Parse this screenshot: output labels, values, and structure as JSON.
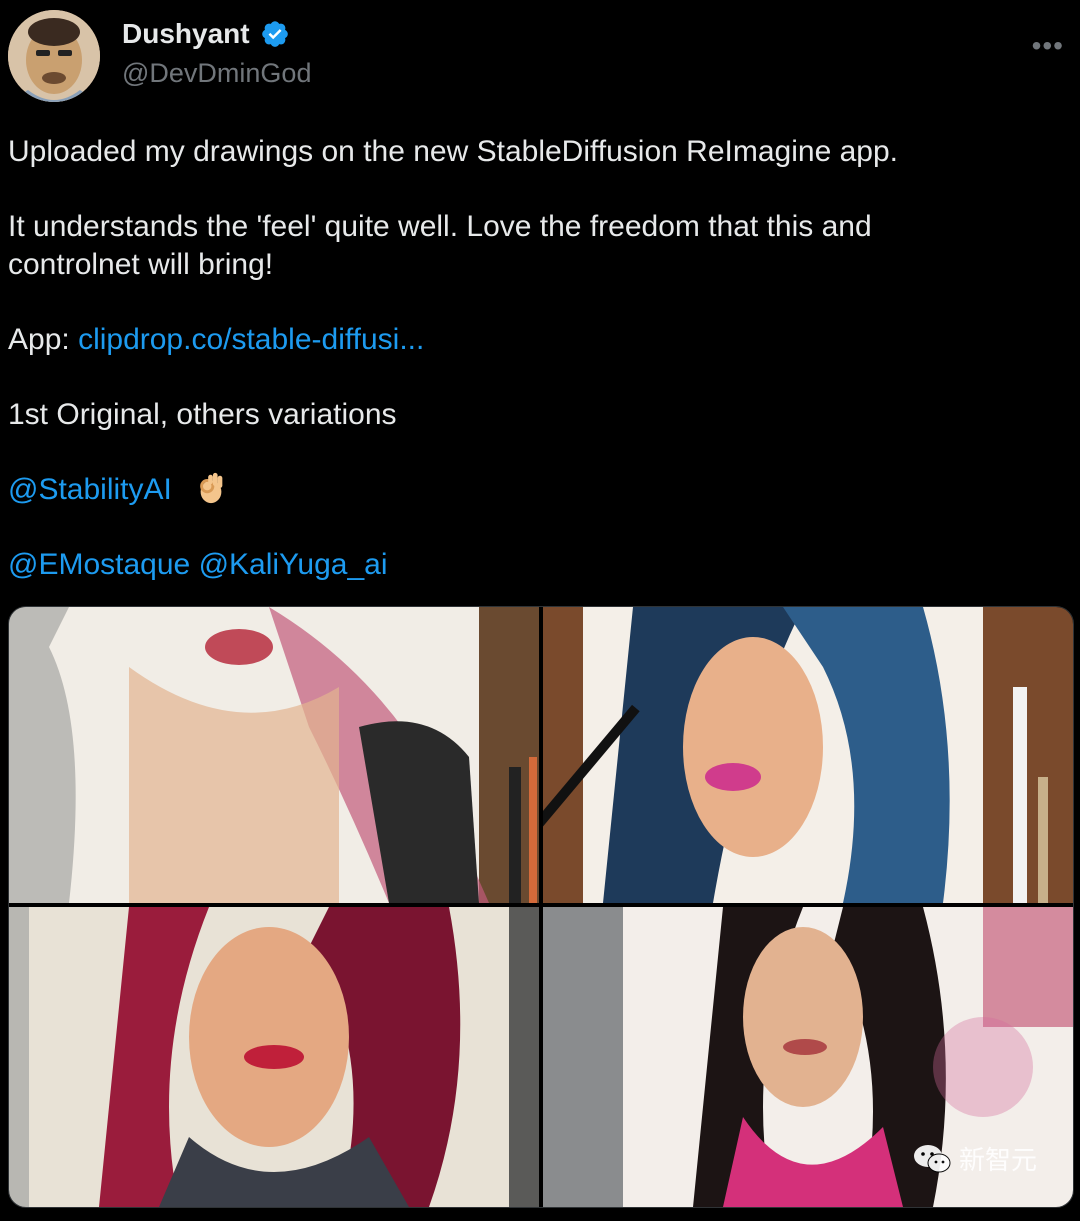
{
  "author": {
    "display_name": "Dushyant",
    "handle": "@DevDminGod",
    "verified_icon": "verified-badge-icon"
  },
  "more_label": "•••",
  "tweet": {
    "line1": "Uploaded my drawings on the new StableDiffusion ReImagine app.",
    "line2": "It understands the 'feel' quite well. Love the freedom that this and",
    "line3": "controlnet will bring!",
    "app_label": "App: ",
    "app_link": "clipdrop.co/stable-diffusi...",
    "line5": "1st Original, others variations",
    "mention1": "@StabilityAI",
    "emoji": "ok-hand-emoji",
    "mention2": "@EMostaque",
    "mention3": "@KaliYuga_ai"
  },
  "media": {
    "images": [
      "original-drawing",
      "variation-1",
      "variation-2",
      "variation-3"
    ]
  },
  "watermark": {
    "text": "新智元"
  },
  "colors": {
    "link": "#1d9bf0",
    "verified": "#1d9bf0",
    "background": "#000000",
    "text": "#e7e9ea",
    "secondary": "#71767b"
  }
}
